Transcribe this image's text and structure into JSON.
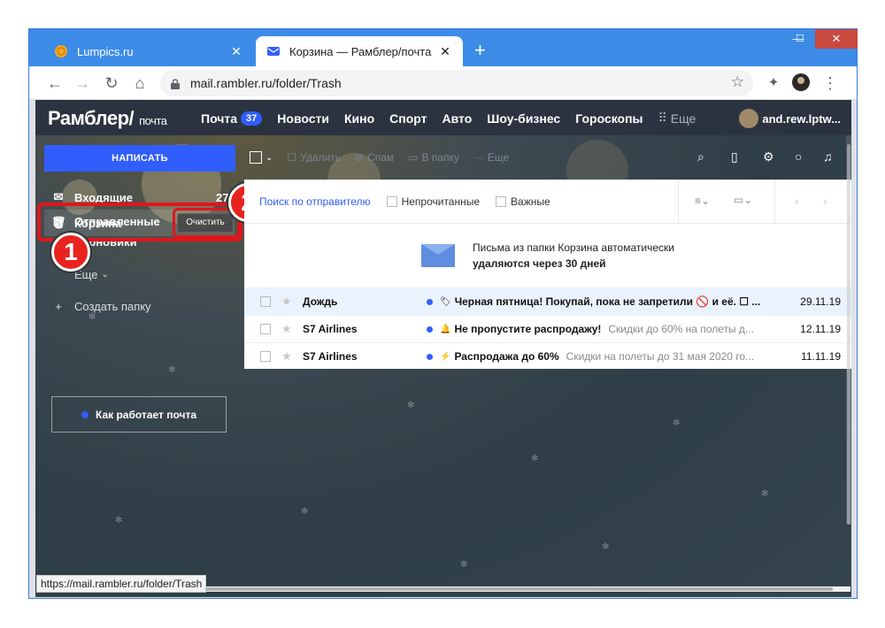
{
  "browser": {
    "tabs": [
      {
        "title": "Lumpics.ru",
        "favicon": "orange-circle-icon",
        "active": false
      },
      {
        "title": "Корзина — Рамблер/почта",
        "favicon": "mail-envelope-icon",
        "active": true
      }
    ],
    "new_tab": "+",
    "url": "mail.rambler.ru/folder/Trash",
    "status_url": "https://mail.rambler.ru/folder/Trash",
    "controls": {
      "minimize": "—",
      "maximize": "☐",
      "close": "✕"
    }
  },
  "rambler": {
    "logo": "Рамблер/",
    "logo_sub": "почта",
    "nav": [
      {
        "label": "Почта",
        "badge": "37"
      },
      {
        "label": "Новости"
      },
      {
        "label": "Кино"
      },
      {
        "label": "Спорт"
      },
      {
        "label": "Авто"
      },
      {
        "label": "Шоу-бизнес"
      },
      {
        "label": "Гороскопы"
      },
      {
        "label": "Еще"
      }
    ],
    "user": "and.rew.lptw..."
  },
  "sidebar": {
    "compose": "НАПИСАТЬ",
    "folders": [
      {
        "label": "Входящие",
        "count": "27",
        "icon": "inbox-icon"
      },
      {
        "label": "Отправленные",
        "icon": "sent-icon"
      },
      {
        "label": "Черновики",
        "icon": "drafts-icon"
      },
      {
        "label": "Корзина",
        "icon": "trash-icon"
      }
    ],
    "clear": "Очистить",
    "more": "Еще",
    "create_folder": "Создать папку",
    "how_it_works": "Как работает почта"
  },
  "toolbar": {
    "delete": "Удалить",
    "spam": "Спам",
    "to_folder": "В папку",
    "more": "Еще"
  },
  "filters": {
    "search_sender": "Поиск по отправителю",
    "unread": "Непрочитанные",
    "important": "Важные"
  },
  "notice": {
    "line1": "Письма из папки Корзина автоматически",
    "line2": "удаляются через 30 дней"
  },
  "messages": [
    {
      "from": "Дождь",
      "subject": "Черная пятница! Покупай, пока не запретили 🚫 и её. ☐ ...",
      "preview": "",
      "date": "29.11.19"
    },
    {
      "from": "S7 Airlines",
      "subject": "Не пропустите распродажу!",
      "preview": "Скидки до 60% на полеты д...",
      "date": "12.11.19"
    },
    {
      "from": "S7 Airlines",
      "subject": "Распродажа до 60%",
      "preview": "Скидки на полеты до 31 мая 2020 го...",
      "date": "11.11.19"
    }
  ],
  "markers": [
    "1",
    "2"
  ],
  "colors": {
    "accent": "#315efb",
    "highlight": "#e0151c",
    "header": "#2c3340"
  }
}
